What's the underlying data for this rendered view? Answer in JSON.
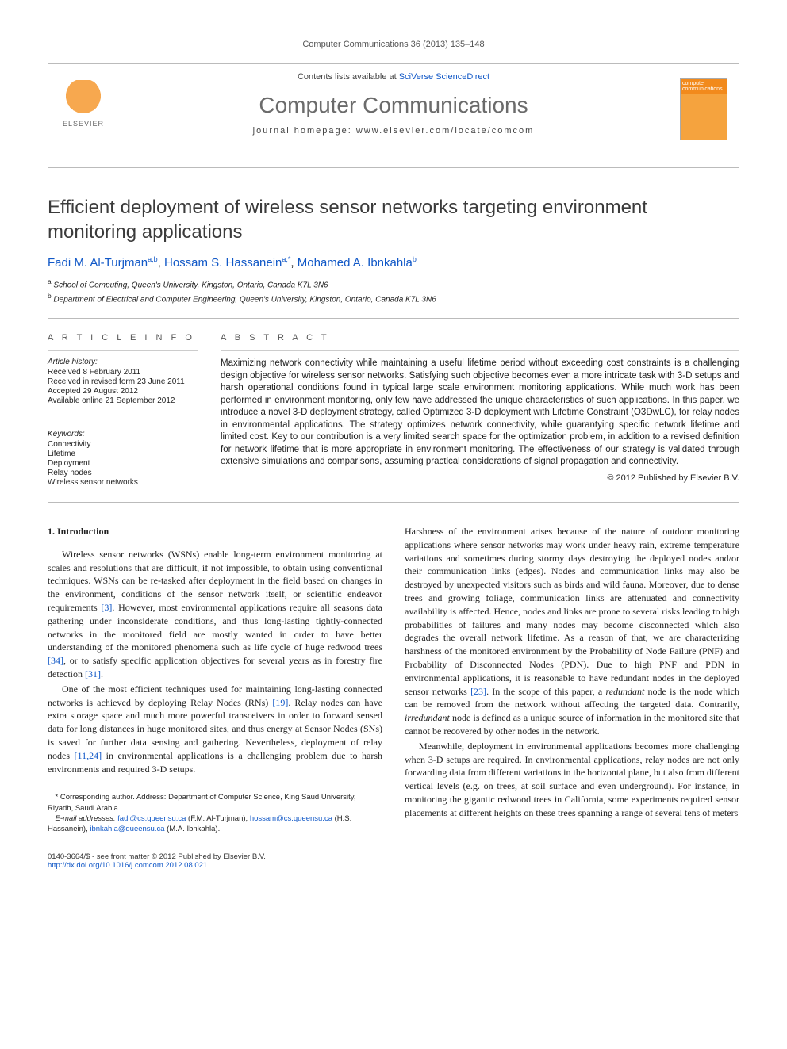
{
  "header_citation": "Computer Communications 36 (2013) 135–148",
  "contents_line_prefix": "Contents lists available at ",
  "contents_link": "SciVerse ScienceDirect",
  "journal_name": "Computer Communications",
  "journal_homepage_label": "journal homepage: ",
  "journal_homepage_url": "www.elsevier.com/locate/comcom",
  "publisher_logo_label": "ELSEVIER",
  "cover_thumb_text": "computer communications",
  "title": "Efficient deployment of wireless sensor networks targeting environment monitoring applications",
  "authors": [
    {
      "name": "Fadi M. Al-Turjman",
      "sup": "a,b"
    },
    {
      "name": "Hossam S. Hassanein",
      "sup": "a,*"
    },
    {
      "name": "Mohamed A. Ibnkahla",
      "sup": "b"
    }
  ],
  "affiliations": [
    {
      "sup": "a",
      "text": "School of Computing, Queen's University, Kingston, Ontario, Canada K7L 3N6"
    },
    {
      "sup": "b",
      "text": "Department of Electrical and Computer Engineering, Queen's University, Kingston, Ontario, Canada K7L 3N6"
    }
  ],
  "article_info_head": "A R T I C L E   I N F O",
  "history_label": "Article history:",
  "history": [
    "Received 8 February 2011",
    "Received in revised form 23 June 2011",
    "Accepted 29 August 2012",
    "Available online 21 September 2012"
  ],
  "keywords_label": "Keywords:",
  "keywords": [
    "Connectivity",
    "Lifetime",
    "Deployment",
    "Relay nodes",
    "Wireless sensor networks"
  ],
  "abstract_head": "A B S T R A C T",
  "abstract": "Maximizing network connectivity while maintaining a useful lifetime period without exceeding cost constraints is a challenging design objective for wireless sensor networks. Satisfying such objective becomes even a more intricate task with 3-D setups and harsh operational conditions found in typical large scale environment monitoring applications. While much work has been performed in environment monitoring, only few have addressed the unique characteristics of such applications. In this paper, we introduce a novel 3-D deployment strategy, called Optimized 3-D deployment with Lifetime Constraint (O3DwLC), for relay nodes in environmental applications. The strategy optimizes network connectivity, while guarantying specific network lifetime and limited cost. Key to our contribution is a very limited search space for the optimization problem, in addition to a revised definition for network lifetime that is more appropriate in environment monitoring. The effectiveness of our strategy is validated through extensive simulations and comparisons, assuming practical considerations of signal propagation and connectivity.",
  "copyright": "© 2012 Published by Elsevier B.V.",
  "intro_head": "1. Introduction",
  "para1": "Wireless sensor networks (WSNs) enable long-term environment monitoring at scales and resolutions that are difficult, if not impossible, to obtain using conventional techniques. WSNs can be re-tasked after deployment in the field based on changes in the environment, conditions of the sensor network itself, or scientific endeavor requirements [3]. However, most environmental applications require all seasons data gathering under inconsiderate conditions, and thus long-lasting tightly-connected networks in the monitored field are mostly wanted in order to have better understanding of the monitored phenomena such as life cycle of huge redwood trees [34], or to satisfy specific application objectives for several years as in forestry fire detection [31].",
  "para2": "One of the most efficient techniques used for maintaining long-lasting connected networks is achieved by deploying Relay Nodes (RNs) [19]. Relay nodes can have extra storage space and much more powerful transceivers in order to forward sensed data for long distances in huge monitored sites, and thus energy at Sensor Nodes (SNs) is saved for further data sensing and gathering. Nevertheless, deployment of relay nodes [11,24] in environmental applications is a challenging problem due to harsh environments and required 3-D setups.",
  "para3": "Harshness of the environment arises because of the nature of outdoor monitoring applications where sensor networks may work under heavy rain, extreme temperature variations and sometimes during stormy days destroying the deployed nodes and/or their communication links (edges). Nodes and communication links may also be destroyed by unexpected visitors such as birds and wild fauna. Moreover, due to dense trees and growing foliage, communication links are attenuated and connectivity availability is affected. Hence, nodes and links are prone to several risks leading to high probabilities of failures and many nodes may become disconnected which also degrades the overall network lifetime. As a reason of that, we are characterizing harshness of the monitored environment by the Probability of Node Failure (PNF) and Probability of Disconnected Nodes (PDN). Due to high PNF and PDN in environmental applications, it is reasonable to have redundant nodes in the deployed sensor networks [23]. In the scope of this paper, a redundant node is the node which can be removed from the network without affecting the targeted data. Contrarily, irredundant node is defined as a unique source of information in the monitored site that cannot be recovered by other nodes in the network.",
  "para4": "Meanwhile, deployment in environmental applications becomes more challenging when 3-D setups are required. In environmental applications, relay nodes are not only forwarding data from different variations in the horizontal plane, but also from different vertical levels (e.g. on trees, at soil surface and even underground). For instance, in monitoring the gigantic redwood trees in California, some experiments required sensor placements at different heights on these trees spanning a range of several tens of meters",
  "refs": {
    "r3": "[3]",
    "r34": "[34]",
    "r31": "[31]",
    "r19": "[19]",
    "r11_24": "[11,24]",
    "r23": "[23]"
  },
  "corr_note": "* Corresponding author. Address: Department of Computer Science, King Saud University, Riyadh, Saudi Arabia.",
  "email_label": "E-mail addresses: ",
  "emails": [
    {
      "addr": "fadi@cs.queensu.ca",
      "who": "(F.M. Al-Turjman)"
    },
    {
      "addr": "hossam@cs.queensu.ca",
      "who": "(H.S. Hassanein)"
    },
    {
      "addr": "ibnkahla@queensu.ca",
      "who": "(M.A. Ibnkahla)"
    }
  ],
  "front_matter": "0140-3664/$ - see front matter © 2012 Published by Elsevier B.V.",
  "doi": "http://dx.doi.org/10.1016/j.comcom.2012.08.021"
}
